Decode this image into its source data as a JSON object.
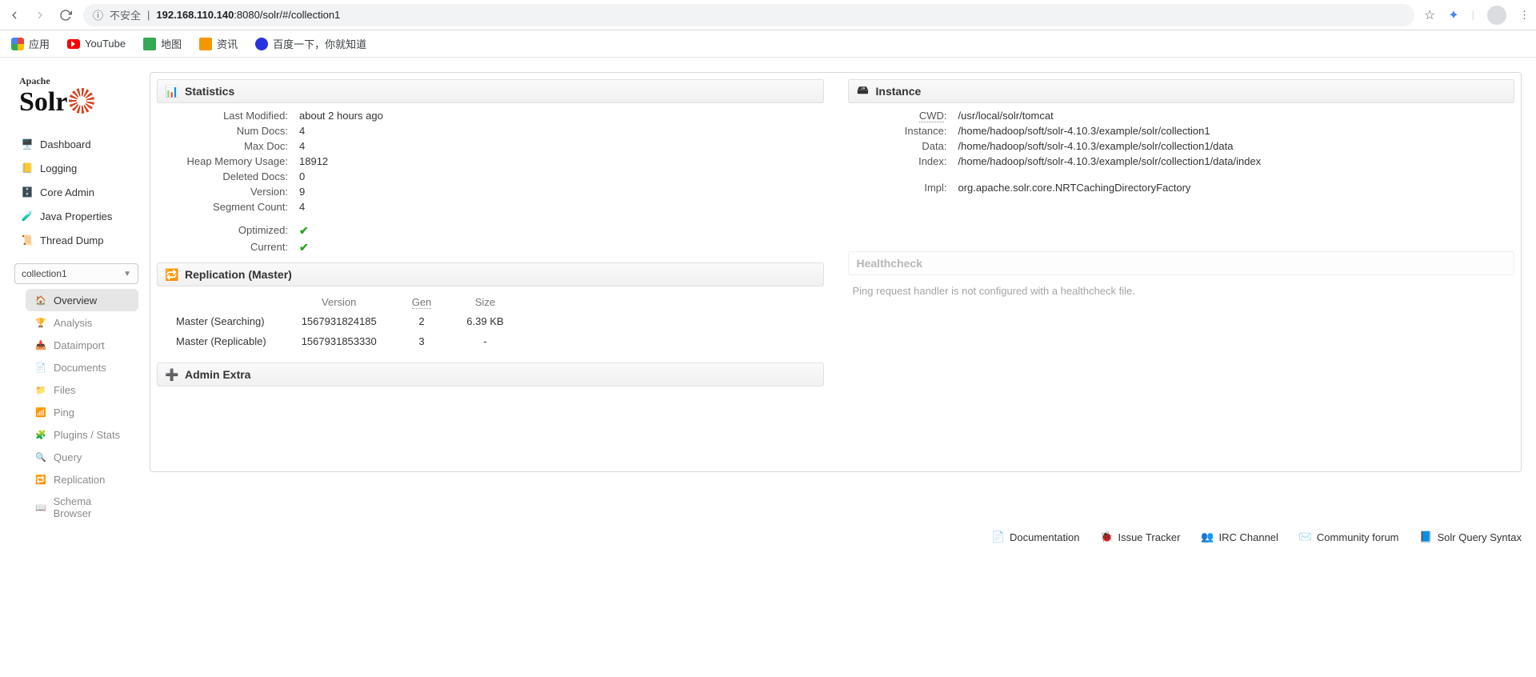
{
  "browser": {
    "insecure_label": "不安全",
    "url_host": "192.168.110.140",
    "url_rest": ":8080/solr/#/collection1"
  },
  "bookmarks": {
    "apps": "应用",
    "youtube": "YouTube",
    "maps": "地图",
    "news": "资讯",
    "baidu": "百度一下，你就知道"
  },
  "logo": {
    "small": "Apache",
    "big": "Solr"
  },
  "nav": {
    "dashboard": "Dashboard",
    "logging": "Logging",
    "core_admin": "Core Admin",
    "java_props": "Java Properties",
    "thread_dump": "Thread Dump"
  },
  "core_selector": {
    "value": "collection1"
  },
  "subnav": {
    "overview": "Overview",
    "analysis": "Analysis",
    "dataimport": "Dataimport",
    "documents": "Documents",
    "files": "Files",
    "ping": "Ping",
    "plugins": "Plugins / Stats",
    "query": "Query",
    "replication": "Replication",
    "schema_browser": "Schema Browser"
  },
  "stats": {
    "title": "Statistics",
    "labels": {
      "last_modified": "Last Modified:",
      "num_docs": "Num Docs:",
      "max_doc": "Max Doc:",
      "heap": "Heap Memory Usage:",
      "deleted": "Deleted Docs:",
      "version": "Version:",
      "seg_count": "Segment Count:",
      "optimized": "Optimized:",
      "current": "Current:"
    },
    "values": {
      "last_modified": "about 2 hours ago",
      "num_docs": "4",
      "max_doc": "4",
      "heap": "18912",
      "deleted": "0",
      "version": "9",
      "seg_count": "4"
    }
  },
  "instance": {
    "title": "Instance",
    "labels": {
      "cwd": "CWD",
      "instance": "Instance:",
      "data": "Data:",
      "index": "Index:",
      "impl": "Impl:"
    },
    "values": {
      "cwd": "/usr/local/solr/tomcat",
      "instance": "/home/hadoop/soft/solr-4.10.3/example/solr/collection1",
      "data": "/home/hadoop/soft/solr-4.10.3/example/solr/collection1/data",
      "index": "/home/hadoop/soft/solr-4.10.3/example/solr/collection1/data/index",
      "impl": "org.apache.solr.core.NRTCachingDirectoryFactory"
    }
  },
  "replication": {
    "title": "Replication (Master)",
    "headers": {
      "blank": "",
      "version": "Version",
      "gen": "Gen",
      "size": "Size"
    },
    "rows": [
      {
        "label": "Master (Searching)",
        "version": "1567931824185",
        "gen": "2",
        "size": "6.39 KB"
      },
      {
        "label": "Master (Replicable)",
        "version": "1567931853330",
        "gen": "3",
        "size": "-"
      }
    ]
  },
  "admin_extra": {
    "title": "Admin Extra"
  },
  "healthcheck": {
    "title": "Healthcheck",
    "message": "Ping request handler is not configured with a healthcheck file."
  },
  "footer": {
    "documentation": "Documentation",
    "issue_tracker": "Issue Tracker",
    "irc": "IRC Channel",
    "forum": "Community forum",
    "query_syntax": "Solr Query Syntax"
  }
}
